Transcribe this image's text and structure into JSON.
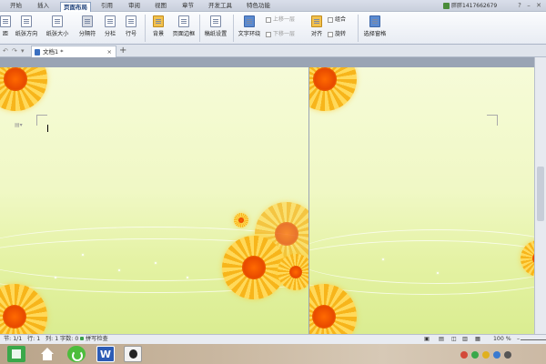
{
  "menu": {
    "items": [
      "开始",
      "插入",
      "页面布局",
      "引用",
      "审阅",
      "视图",
      "章节",
      "开发工具",
      "特色功能"
    ],
    "active": "页面布局"
  },
  "user": {
    "name": "胖胖1417662679"
  },
  "window_controls": [
    "?",
    "–",
    "✕"
  ],
  "ribbon": {
    "buttons": {
      "border_partial": "距",
      "orientation": "纸张方向",
      "size": "纸张大小",
      "columns_break": "分隔符",
      "columns": "分栏",
      "line_numbers": "行号",
      "background": "背景",
      "page_border": "页面边框",
      "draft_settings": "稿纸设置",
      "text_wrap": "文字环绕",
      "align": "对齐",
      "selection_pane": "选择窗格"
    },
    "small": {
      "bring_forward": "上移一层",
      "send_backward": "下移一层",
      "group": "组合",
      "rotate": "旋转"
    }
  },
  "document_tab": {
    "title": "文档1 *",
    "close": "×",
    "new": "+"
  },
  "statusbar": {
    "section": "节: 1/1",
    "row": "行: 1",
    "col": "列: 1",
    "word_count": "字数: 0",
    "spell_check": "拼写检查",
    "zoom": "100 %"
  },
  "colors": {
    "page_top": "#f6fbd8",
    "page_bottom": "#d9ec8f",
    "flower": "#f7b51b",
    "flower_center": "#e84a00",
    "menubar": "#d3d9e6"
  },
  "icons": {
    "taskbar": [
      "start-icon",
      "home-icon",
      "refresh-icon",
      "wps-writer-icon",
      "profile-face-icon"
    ]
  }
}
